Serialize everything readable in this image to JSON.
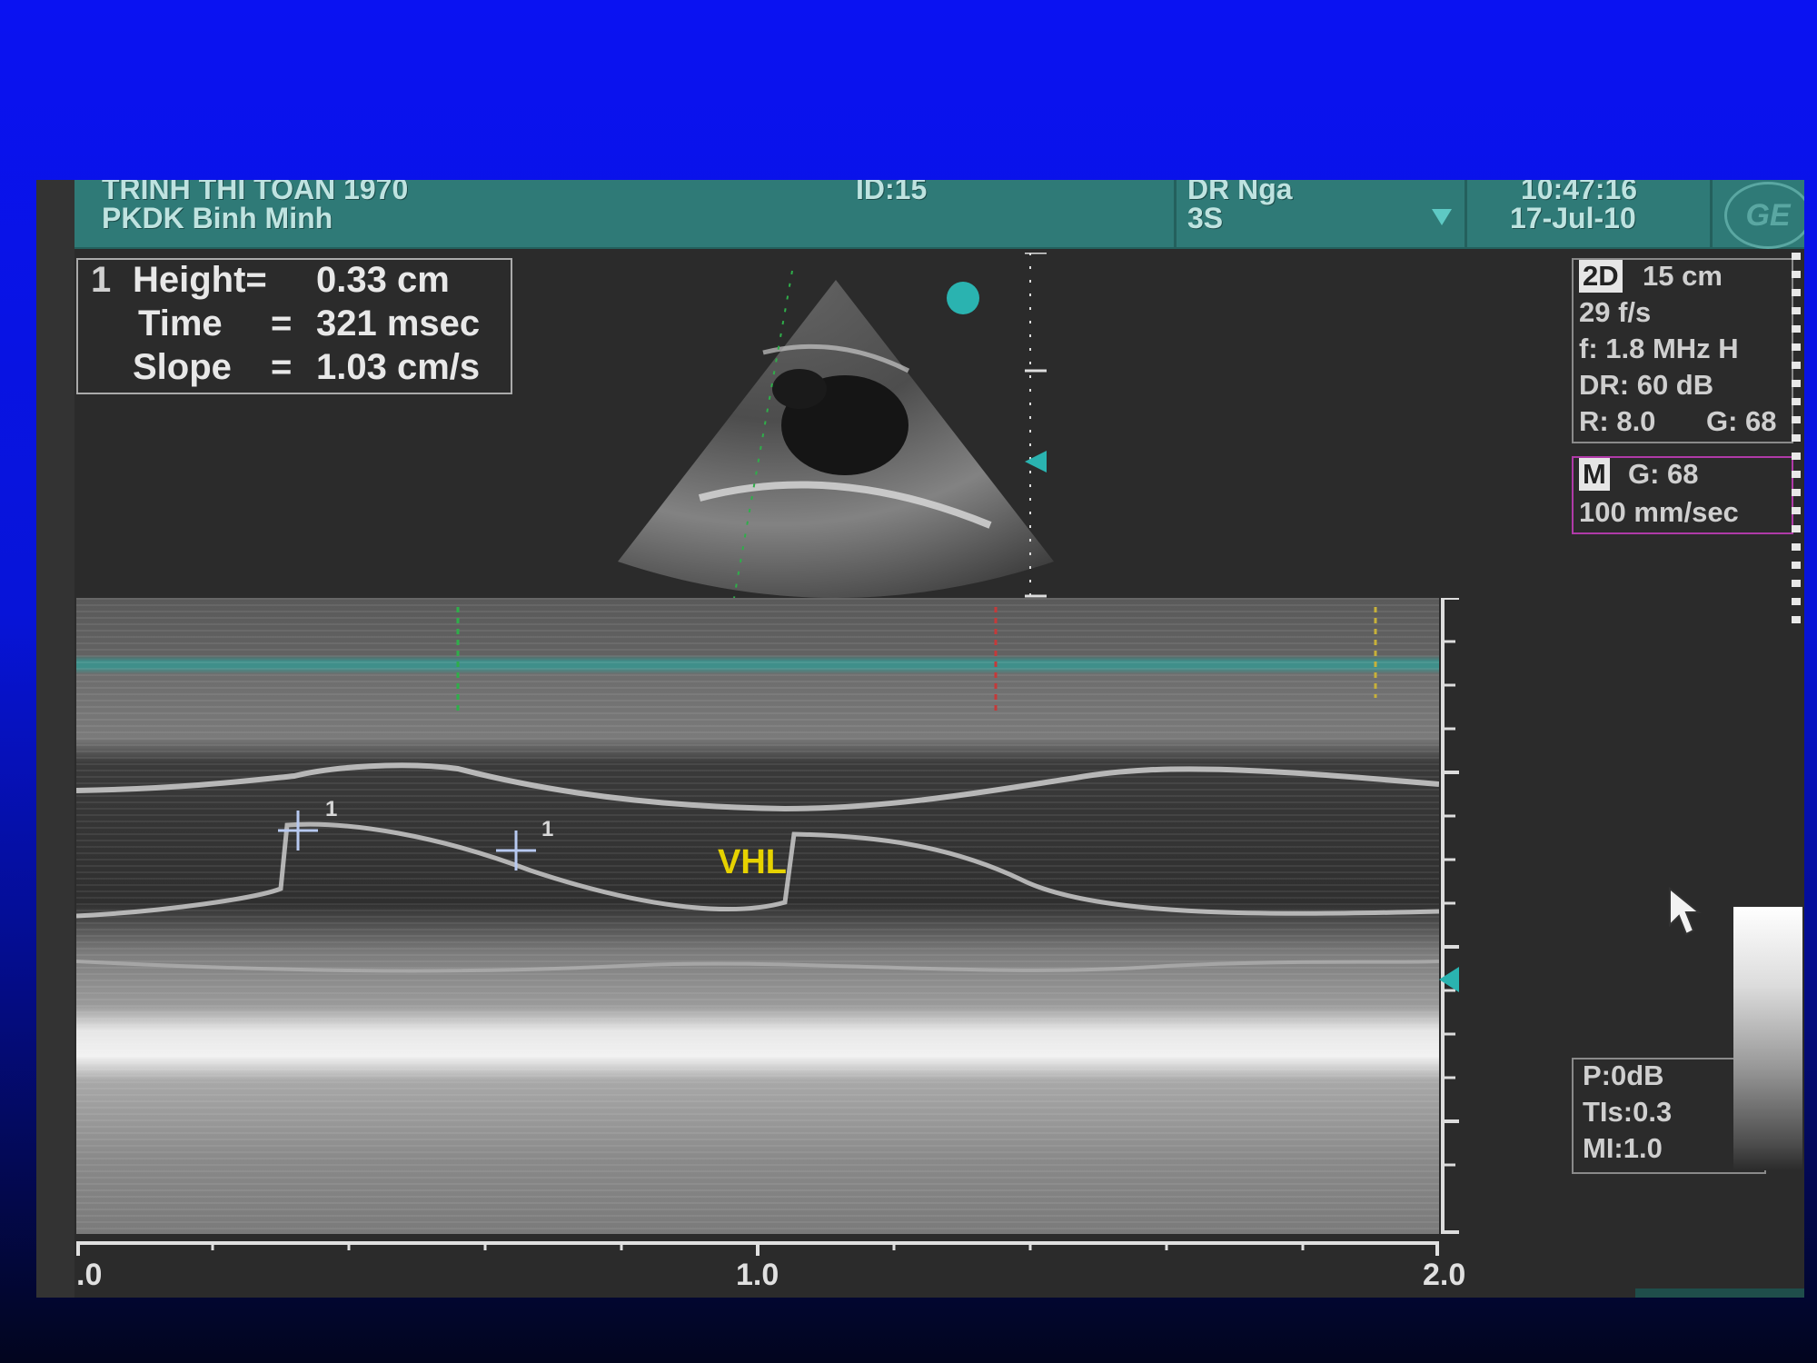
{
  "header": {
    "patient_name": "TRINH THI TOAN 1970",
    "clinic": "PKDK Binh Minh",
    "patient_id": "ID:15",
    "physician": "DR Nga",
    "probe": "3S",
    "time": "10:47:16",
    "date": "17-Jul-10",
    "logo": "GE"
  },
  "measurement": {
    "index": "1",
    "height_label": "Height=",
    "height_value": "0.33 cm",
    "time_label": "Time",
    "time_eq": "=",
    "time_value": "321 msec",
    "slope_label": "Slope",
    "slope_eq": "=",
    "slope_value": "1.03 cm/s"
  },
  "params_2d": {
    "mode": "2D",
    "depth": "15 cm",
    "frame_rate": "29 f/s",
    "frequency": "f: 1.8 MHz H",
    "dynamic_range": "DR: 60 dB",
    "reject": "R: 8.0",
    "gain": "G: 68"
  },
  "params_m": {
    "mode": "M",
    "gain": "G: 68",
    "sweep": "100 mm/sec"
  },
  "power": {
    "output": "P:0dB",
    "tis": "TIs:0.3",
    "mi": "MI:1.0"
  },
  "annotation": {
    "label": "VHL",
    "caliper_index": "1"
  },
  "time_axis": {
    "labels": [
      ".0",
      "1.0",
      "2.0"
    ]
  },
  "colors": {
    "header_bg": "#2f7a77",
    "header_text": "#bfe3e0",
    "accent_cyan": "#2ab3b0",
    "label_yellow": "#e6d200",
    "m_box_border": "#b03aa8"
  },
  "icons": {
    "focus_marker": "cyan-triangle-icon",
    "pointer": "mouse-cursor-icon",
    "caliper": "caliper-cross-icon",
    "probe_dropdown": "triangle-down-icon"
  }
}
